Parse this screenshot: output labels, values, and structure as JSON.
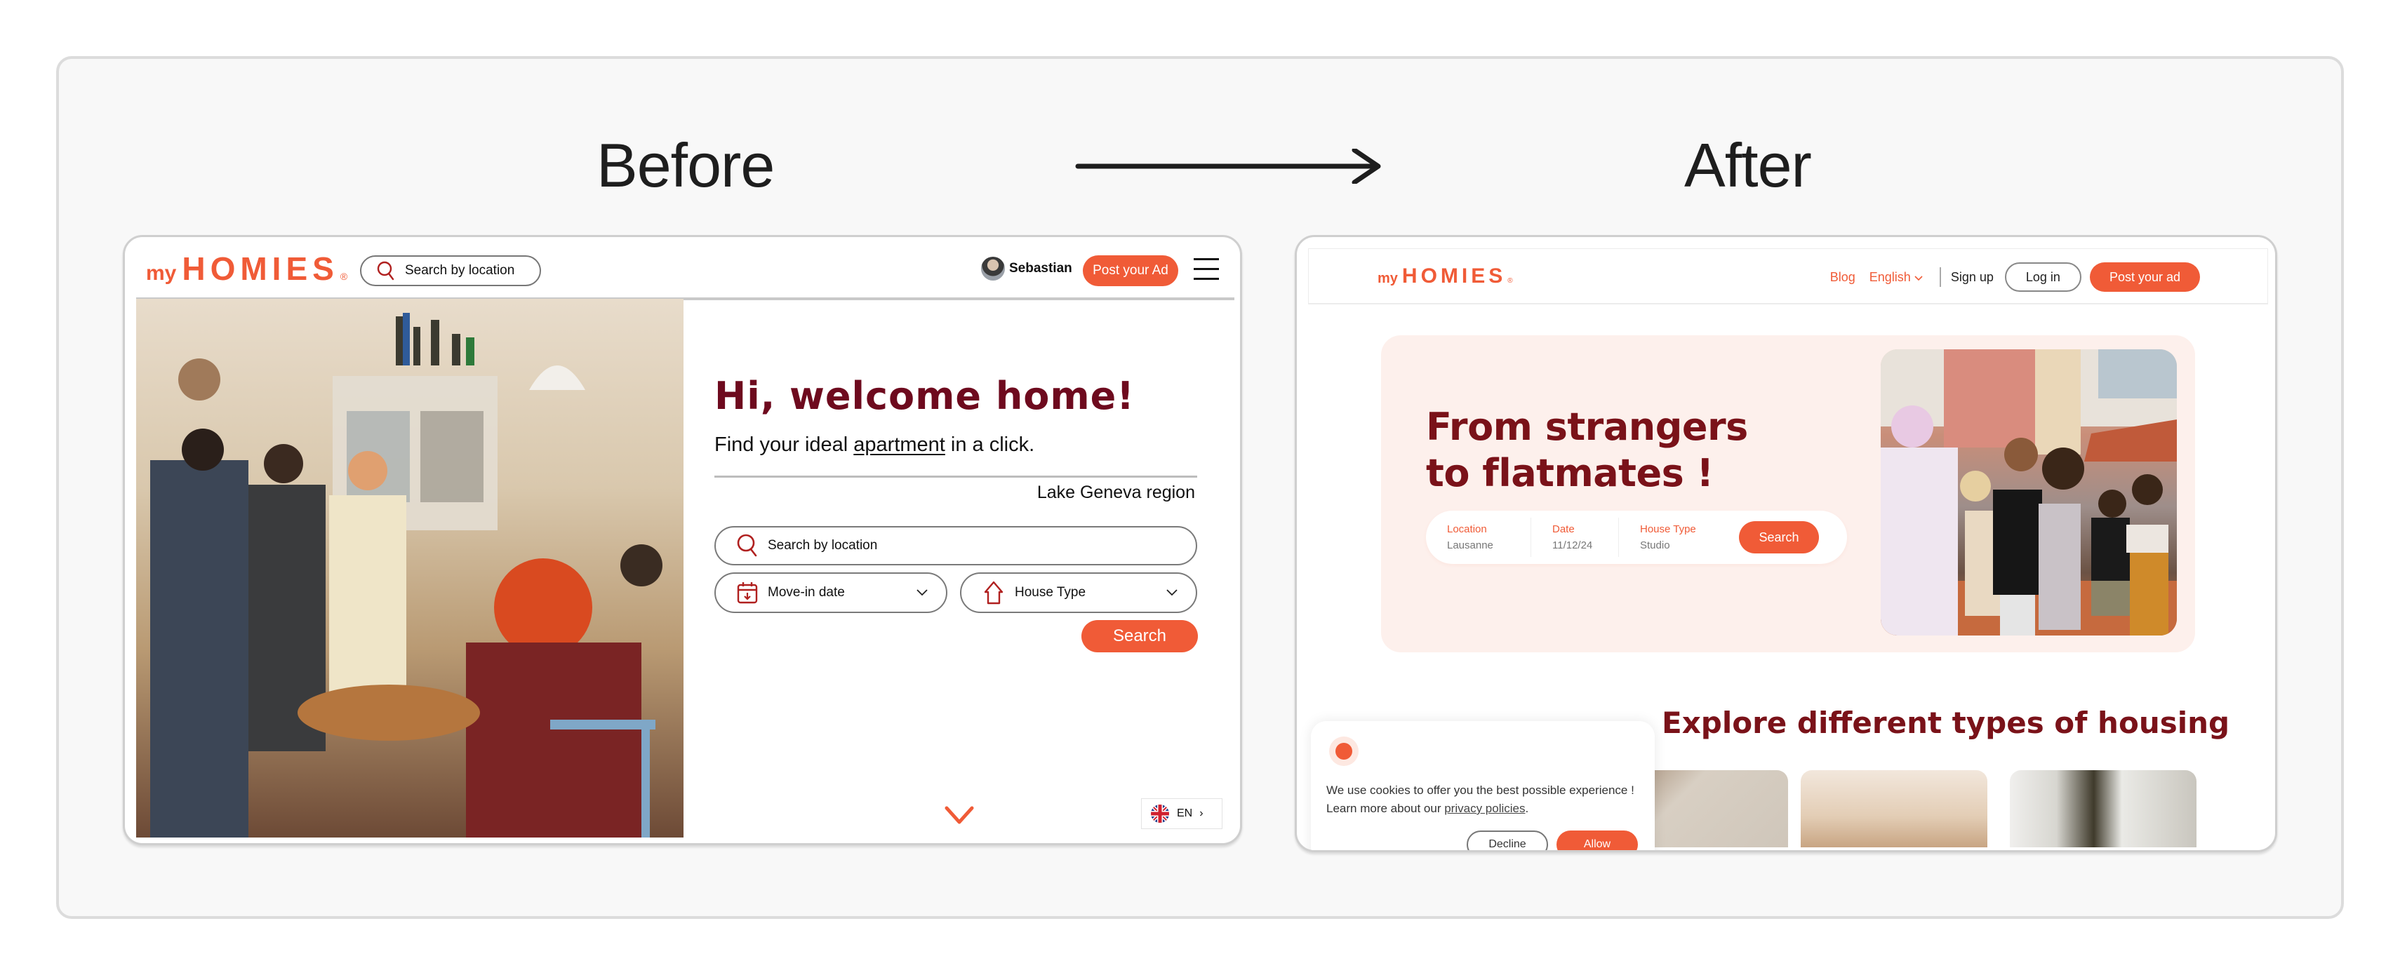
{
  "comparison": {
    "before_label": "Before",
    "after_label": "After",
    "arrow_icon": "long-right-arrow"
  },
  "before": {
    "logo": {
      "prefix": "my",
      "word": "HOMIES",
      "reg": "®"
    },
    "header": {
      "search_placeholder": "Search by location",
      "user_name": "Sebastian",
      "post_button": "Post your Ad",
      "menu_icon": "hamburger-icon"
    },
    "hero": {
      "title": "Hi, welcome home!",
      "subtitle_before": "Find your ideal ",
      "subtitle_link": "apartment",
      "subtitle_after": " in a click.",
      "region": "Lake Geneva region"
    },
    "search_form": {
      "location_placeholder": "Search by location",
      "move_in_placeholder": "Move-in date",
      "house_type_placeholder": "House Type",
      "search_button": "Search"
    },
    "language": {
      "code": "EN",
      "flag": "uk-flag"
    },
    "colors": {
      "accent": "#f05b37",
      "title": "#6e0a1e"
    }
  },
  "after": {
    "logo": {
      "prefix": "my",
      "word": "HOMIES",
      "reg": "®"
    },
    "nav": {
      "blog": "Blog",
      "language": "English",
      "sign_up": "Sign up",
      "log_in": "Log in",
      "post_button": "Post your ad"
    },
    "hero": {
      "title_line1": "From strangers",
      "title_line2": "to flatmates !",
      "search": {
        "location_label": "Location",
        "location_value": "Lausanne",
        "date_label": "Date",
        "date_value": "11/12/24",
        "house_type_label": "House Type",
        "house_type_value": "Studio",
        "button": "Search"
      }
    },
    "section_title": "Explore different types of housing",
    "cookie_banner": {
      "text": "We use cookies to offer you the best possible experience ! Learn more about our ",
      "link": "privacy policies",
      "text_end": ".",
      "decline": "Decline",
      "allow": "Allow"
    },
    "colors": {
      "accent": "#f05b37",
      "title": "#7a1219",
      "hero_bg": "#fdf0ec"
    }
  }
}
